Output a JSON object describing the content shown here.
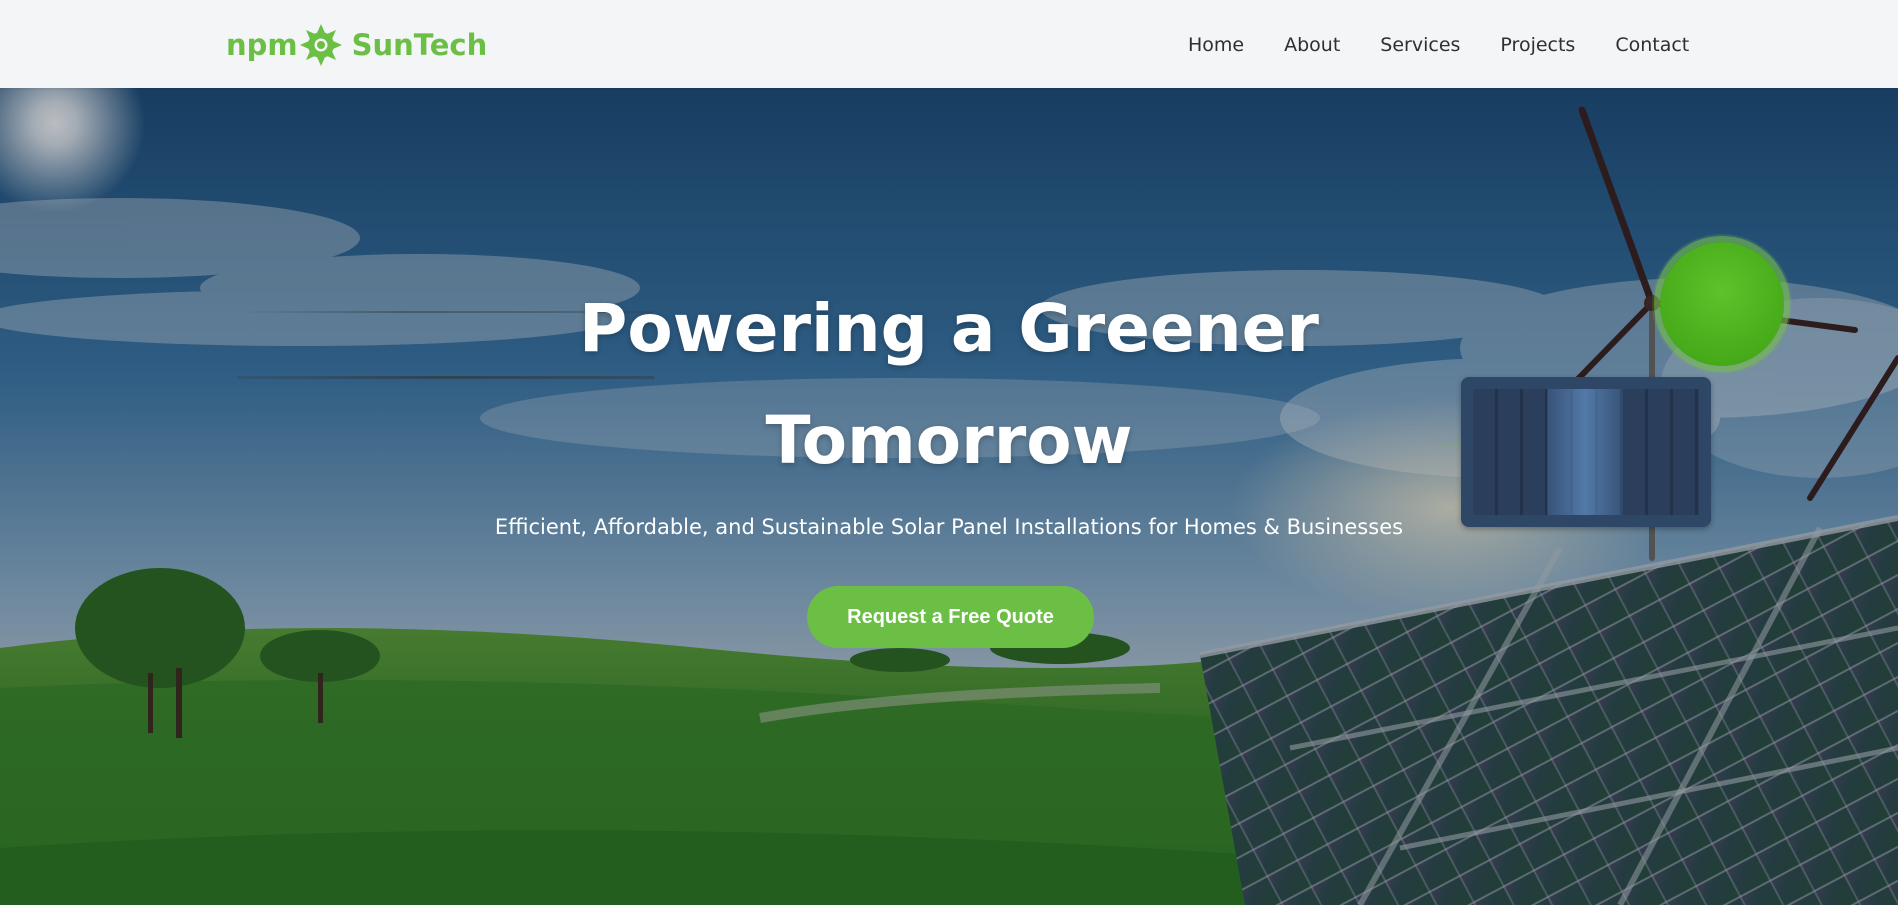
{
  "header": {
    "logo": {
      "prefix": "npm",
      "brand": "SunTech",
      "icon": "sun-icon"
    },
    "nav": [
      {
        "label": "Home"
      },
      {
        "label": "About"
      },
      {
        "label": "Services"
      },
      {
        "label": "Projects"
      },
      {
        "label": "Contact"
      }
    ]
  },
  "hero": {
    "title_line1": "Powering a Greener",
    "title_line2": "Tomorrow",
    "subtitle": "Efficient, Affordable, and Sustainable Solar Panel Installations for Homes & Businesses",
    "cta_label": "Request a Free Quote"
  },
  "colors": {
    "accent": "#6bbf45",
    "header_bg": "#f3f5f7",
    "nav_text": "#2f2f2f",
    "hero_text": "#ffffff"
  }
}
